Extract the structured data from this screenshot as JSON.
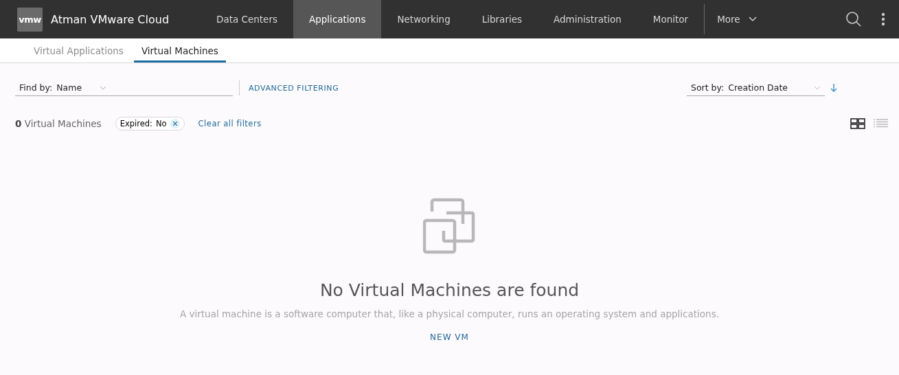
{
  "header": {
    "logo": "vmw",
    "title": "Atman VMware Cloud",
    "nav": [
      {
        "label": "Data Centers",
        "selected": false
      },
      {
        "label": "Applications",
        "selected": true
      },
      {
        "label": "Networking",
        "selected": false
      },
      {
        "label": "Libraries",
        "selected": false
      },
      {
        "label": "Administration",
        "selected": false
      },
      {
        "label": "Monitor",
        "selected": false
      }
    ],
    "more": "More"
  },
  "tabs": [
    {
      "label": "Virtual Applications",
      "selected": false
    },
    {
      "label": "Virtual Machines",
      "selected": true
    }
  ],
  "filter": {
    "find_label": "Find by:",
    "find_value": "Name",
    "advanced": "ADVANCED FILTERING",
    "sort_label": "Sort by:",
    "sort_value": "Creation Date"
  },
  "summary": {
    "count": "0",
    "label": "Virtual Machines",
    "chip_label": "Expired:",
    "chip_value": "No",
    "clear": "Clear all filters"
  },
  "views": [
    {
      "kind": "grid",
      "selected": true
    },
    {
      "kind": "list",
      "selected": false
    }
  ],
  "empty": {
    "title": "No Virtual Machines are found",
    "text": "A virtual machine is a software computer that, like a physical computer, runs an operating system and applications.",
    "action": "NEW VM"
  }
}
